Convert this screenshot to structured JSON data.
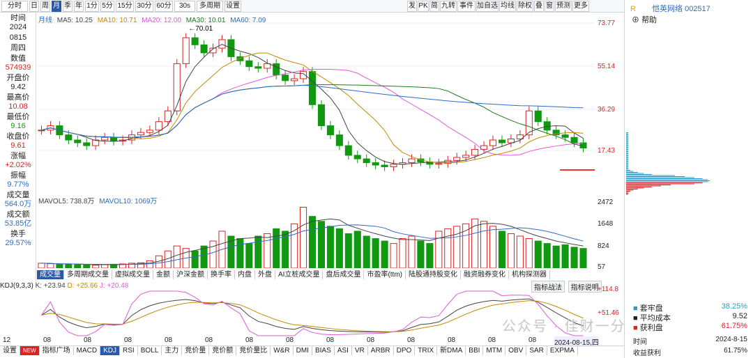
{
  "toolbar": {
    "left_buttons": [
      "分时",
      "日",
      "周",
      "月",
      "季",
      "年",
      "1分",
      "5分",
      "15分",
      "30分",
      "60分",
      "30s",
      "多周期",
      "设置"
    ],
    "active": "月",
    "right_buttons": [
      "发",
      "PK",
      "简",
      "九转",
      "事件",
      "加自选",
      "均线",
      "除权",
      "叠",
      "窗",
      "预测",
      "更多"
    ]
  },
  "left_panel": [
    {
      "label": "时间",
      "value": "2024"
    },
    {
      "label": "",
      "value": "0815"
    },
    {
      "label": "",
      "value": "周四"
    },
    {
      "label": "数值",
      "value": "574939"
    },
    {
      "label": "开盘价",
      "value": "9.42"
    },
    {
      "label": "最高价",
      "value": "10.08"
    },
    {
      "label": "最低价",
      "value": "9.16"
    },
    {
      "label": "收盘价",
      "value": "9.61"
    },
    {
      "label": "涨幅",
      "value": "+2.02%"
    },
    {
      "label": "振幅",
      "value": "9.77%"
    },
    {
      "label": "成交量",
      "value": "564.0万"
    },
    {
      "label": "成交额",
      "value": "53.85亿"
    },
    {
      "label": "换手",
      "value": "29.57%"
    }
  ],
  "ma_legend": {
    "period": "月线",
    "ma5": "MA5: 10.25",
    "ma10": "MA10: 10.71",
    "ma20": "MA20: 12.00",
    "ma30": "MA30: 10.01",
    "ma60": "MA60: 7.09"
  },
  "price_axis": [
    "73.77",
    "55.14",
    "36.29",
    "17.43"
  ],
  "peak_label": "70.01",
  "vol_legend": {
    "mavol5": "MAVOL5: 738.8万",
    "mavol10": "MAVOL10: 1069万"
  },
  "vol_axis": [
    "2472",
    "1648",
    "824",
    "57"
  ],
  "indicator_tabs": [
    "成交量",
    "多周期成交量",
    "虚拟成交量",
    "金额",
    "沪深金额",
    "换手率",
    "内盘",
    "外盘",
    "AI立桩成交量",
    "盘后成交量",
    "市盈率(ttm)",
    "陆股通持股变化",
    "融资融券变化",
    "机构探测器"
  ],
  "kdj_legend": {
    "name": "KDJ(9,3,3)",
    "k": "K: +23.94",
    "d": "D: +25.66",
    "j": "J: +20.48"
  },
  "kdj_buttons": [
    "指标战法",
    "指标说明"
  ],
  "kdj_axis": [
    "+114.8",
    "+51.46"
  ],
  "x_labels": [
    "12",
    "08",
    "08",
    "08",
    "08",
    "08",
    "08",
    "08",
    "08",
    "08",
    "08",
    "08",
    "08",
    "08"
  ],
  "x_last": "2024-08-15,四",
  "bottom_tabs": [
    "设置",
    "NEW",
    "指标广场",
    "MACD",
    "KDJ",
    "RSI",
    "BOLL",
    "主力",
    "竞价量",
    "竞价额",
    "竞价量比",
    "W&R",
    "DMI",
    "BIAS",
    "ASI",
    "VR",
    "ARBR",
    "DPO",
    "TRIX",
    "新DMA",
    "BBI",
    "MTM",
    "OBV",
    "SAR",
    "EXPMA"
  ],
  "right_panel": {
    "badge": "R",
    "title": "恺英网络 002517",
    "help": "帮助",
    "stats": [
      {
        "label": "套牢盘",
        "value": "38.25%"
      },
      {
        "label": "平均成本",
        "value": "9.52"
      },
      {
        "label": "获利盘",
        "value": "61.75%"
      }
    ],
    "time_label": "时间",
    "time_value": "2024-8-15",
    "profit_label": "收益获利",
    "profit_value": "61.75%"
  },
  "watermark": "公众号 · 佳财一分钟",
  "chart_data": {
    "type": "candlestick",
    "closes": [
      13,
      14,
      12,
      11,
      10.5,
      10,
      11,
      11.5,
      10.8,
      11,
      12,
      12.5,
      13,
      15,
      18,
      40,
      62,
      55,
      48,
      52,
      60,
      45,
      42,
      38,
      37,
      40,
      33,
      30,
      31,
      35,
      20,
      14,
      12,
      10,
      8.5,
      8,
      7.5,
      7.2,
      7,
      7.3,
      7.5,
      8,
      7.6,
      7.3,
      7.4,
      7.8,
      8.2,
      8.5,
      9.4,
      10,
      11,
      10.5,
      11.2,
      12,
      18,
      15,
      13,
      12,
      11.5,
      10.5,
      9.61
    ],
    "volumes": [
      200,
      180,
      150,
      160,
      140,
      130,
      120,
      150,
      160,
      170,
      200,
      220,
      300,
      500,
      700,
      900,
      800,
      700,
      900,
      1100,
      1500,
      1300,
      1200,
      1000,
      1300,
      1400,
      1600,
      1500,
      1800,
      2472,
      2100,
      1900,
      1700,
      1600,
      1400,
      1500,
      1300,
      1200,
      1100,
      1000,
      1200,
      1300,
      1100,
      1000,
      1500,
      1600,
      1700,
      1800,
      2000,
      1900,
      1700,
      1500,
      1400,
      1300,
      1200,
      1100,
      1000,
      900,
      950,
      850,
      800
    ],
    "ylim": [
      5,
      75
    ],
    "vol_ylim": [
      0,
      2600
    ],
    "kdj_ylim": [
      -10,
      120
    ]
  }
}
